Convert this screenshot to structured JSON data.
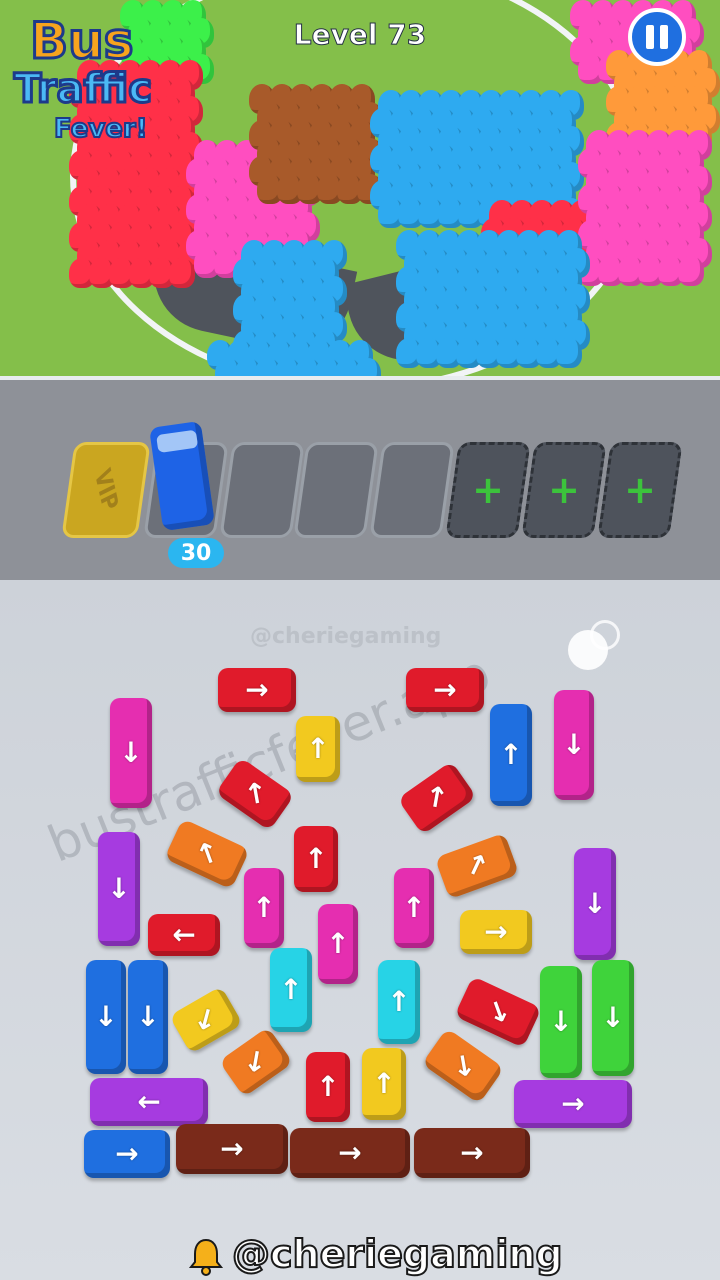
{
  "header": {
    "logo_line1": "Bus",
    "logo_line2": "Traffic",
    "logo_line3": "Fever!",
    "level_label": "Level 73",
    "pause_icon": "pause-icon"
  },
  "parking": {
    "vip_label": "VIP",
    "bus_counter": "30",
    "locked_slot_icon": "plus-icon",
    "plus_symbol": "+"
  },
  "watermarks": {
    "top_handle": "@cheriegaming",
    "diagonal": "bustrafficfever.app",
    "bottom_handle": "@cheriegaming"
  },
  "colors": {
    "red": "#e01b2b",
    "magenta": "#e52eb0",
    "yellow": "#f2c91f",
    "blue": "#1f6fe0",
    "orange": "#f07a22",
    "purple": "#a63be0",
    "cyan": "#27d3e6",
    "green": "#3fd33b",
    "brown": "#7a2a1a",
    "crowd_blue": "#2eaaf0",
    "crowd_pink": "#ff4ec0",
    "crowd_red": "#ff3048",
    "crowd_brown": "#a85a2a",
    "crowd_green": "#3cf04a",
    "crowd_orange": "#ff9a3a"
  },
  "vehicles": [
    {
      "color": "red",
      "type": "bus",
      "dir": "→"
    },
    {
      "color": "red",
      "type": "bus",
      "dir": "→"
    },
    {
      "color": "magenta",
      "type": "bus",
      "dir": "↓"
    },
    {
      "color": "yellow",
      "type": "car",
      "dir": "↑"
    },
    {
      "color": "blue",
      "type": "bus",
      "dir": "↑"
    },
    {
      "color": "magenta",
      "type": "bus",
      "dir": "↓"
    },
    {
      "color": "red",
      "type": "car",
      "dir": "↖"
    },
    {
      "color": "red",
      "type": "car",
      "dir": "↗"
    },
    {
      "color": "orange",
      "type": "car",
      "dir": "↖"
    },
    {
      "color": "red",
      "type": "car",
      "dir": "↑"
    },
    {
      "color": "orange",
      "type": "car",
      "dir": "↗"
    },
    {
      "color": "purple",
      "type": "bus",
      "dir": "↓"
    },
    {
      "color": "purple",
      "type": "bus",
      "dir": "↓"
    },
    {
      "color": "magenta",
      "type": "car",
      "dir": "↑"
    },
    {
      "color": "magenta",
      "type": "car",
      "dir": "↑"
    },
    {
      "color": "red",
      "type": "car",
      "dir": "←"
    },
    {
      "color": "magenta",
      "type": "car",
      "dir": "↑"
    },
    {
      "color": "yellow",
      "type": "car",
      "dir": "→"
    },
    {
      "color": "blue",
      "type": "bus",
      "dir": "↓"
    },
    {
      "color": "blue",
      "type": "bus",
      "dir": "↓"
    },
    {
      "color": "cyan",
      "type": "car",
      "dir": "↑"
    },
    {
      "color": "cyan",
      "type": "car",
      "dir": "↑"
    },
    {
      "color": "yellow",
      "type": "car",
      "dir": "↙"
    },
    {
      "color": "red",
      "type": "car",
      "dir": "↘"
    },
    {
      "color": "green",
      "type": "bus",
      "dir": "↓"
    },
    {
      "color": "green",
      "type": "bus",
      "dir": "↓"
    },
    {
      "color": "orange",
      "type": "car",
      "dir": "↙"
    },
    {
      "color": "red",
      "type": "car",
      "dir": "↑"
    },
    {
      "color": "yellow",
      "type": "car",
      "dir": "↑"
    },
    {
      "color": "orange",
      "type": "car",
      "dir": "↘"
    },
    {
      "color": "purple",
      "type": "bus",
      "dir": "←"
    },
    {
      "color": "purple",
      "type": "bus",
      "dir": "→"
    },
    {
      "color": "blue",
      "type": "bus",
      "dir": "→"
    },
    {
      "color": "brown",
      "type": "bus",
      "dir": "→"
    },
    {
      "color": "brown",
      "type": "bus",
      "dir": "→"
    },
    {
      "color": "brown",
      "type": "bus",
      "dir": "→"
    }
  ]
}
